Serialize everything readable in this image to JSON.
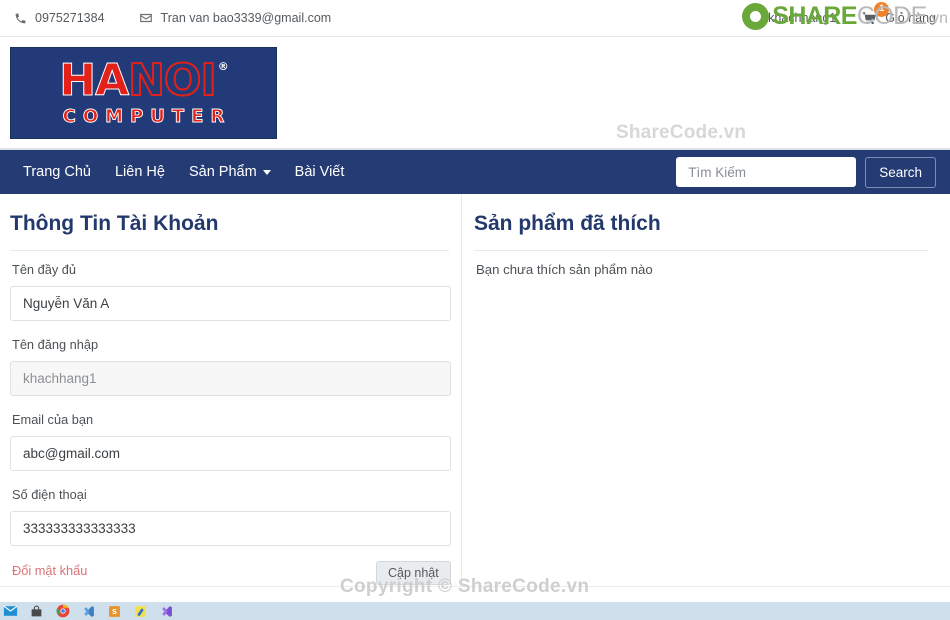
{
  "topbar": {
    "phone": "0975271384",
    "phone_icon": "phone-icon",
    "email": "Tran van bao3339@gmail.com",
    "email_icon": "envelope-icon",
    "account_name": "khachhang1",
    "account_icon": "user-icon",
    "cart_label": "Giỏ hàng",
    "cart_icon": "cart-icon",
    "cart_count": "1"
  },
  "brand": {
    "logo_line1_a": "HA",
    "logo_line1_b": "NOI",
    "logo_registered": "®",
    "logo_line2": "COMPUTER",
    "header_watermark": "ShareCode.vn"
  },
  "nav": {
    "items": [
      {
        "label": "Trang Chủ",
        "has_caret": false
      },
      {
        "label": "Liên Hệ",
        "has_caret": false
      },
      {
        "label": "Sản Phẩm",
        "has_caret": true
      },
      {
        "label": "Bài Viết",
        "has_caret": false
      }
    ],
    "search_placeholder": "Tìm Kiếm",
    "search_value": "",
    "search_button": "Search"
  },
  "account_panel": {
    "title": "Thông Tin Tài Khoản",
    "fields": [
      {
        "label": "Tên đầy đủ",
        "value": "Nguyễn Văn A",
        "disabled": false
      },
      {
        "label": "Tên đăng nhập",
        "value": "khachhang1",
        "disabled": true
      },
      {
        "label": "Email của bạn",
        "value": "abc@gmail.com",
        "disabled": false
      },
      {
        "label": "Số điện thoại",
        "value": "333333333333333",
        "disabled": false
      }
    ],
    "change_password_link": "Đổi mật khẩu",
    "submit_label": "Cập nhật"
  },
  "liked_panel": {
    "title": "Sản phẩm đã thích",
    "empty_message": "Bạn chưa thích sản phẩm nào"
  },
  "watermark": {
    "footer": "Copyright © ShareCode.vn",
    "logo_share": "SHARE",
    "logo_code": "CODE",
    "logo_vn": ".vn"
  },
  "taskbar": {
    "items": [
      {
        "name": "mail-icon",
        "glyph": "✉"
      },
      {
        "name": "store-icon",
        "glyph": "🛍"
      },
      {
        "name": "chrome-icon",
        "glyph": "◉"
      },
      {
        "name": "vscode-icon",
        "glyph": "⧉"
      },
      {
        "name": "sublime-icon",
        "glyph": "S"
      },
      {
        "name": "editor-icon",
        "glyph": "⌗"
      },
      {
        "name": "vscode-insiders-icon",
        "glyph": "⧗"
      }
    ]
  },
  "colors": {
    "nav_blue": "#243b74",
    "heading_blue": "#23386c",
    "logo_red": "#e32119",
    "danger_link": "#d9737a",
    "badge_orange": "#f0832a",
    "watermark_green": "#6aa83a"
  }
}
